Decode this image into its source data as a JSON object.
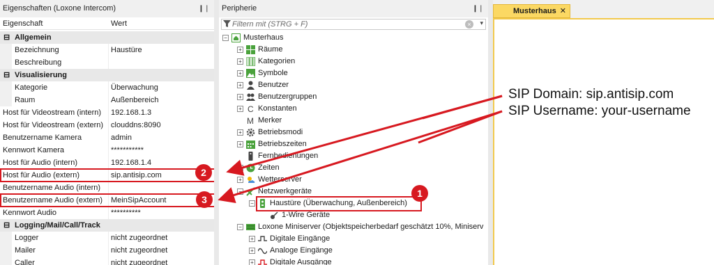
{
  "properties_panel": {
    "title": "Eigenschaften (Loxone Intercom)",
    "pin": "❙❘",
    "header_key": "Eigenschaft",
    "header_value": "Wert",
    "rows": [
      {
        "type": "cat",
        "toggle": "⊟",
        "key": "Allgemein"
      },
      {
        "type": "prop",
        "indent": true,
        "key": "Bezeichnung",
        "value": "Haustüre"
      },
      {
        "type": "prop",
        "indent": true,
        "key": "Beschreibung",
        "value": ""
      },
      {
        "type": "cat",
        "toggle": "⊟",
        "key": "Visualisierung"
      },
      {
        "type": "prop",
        "indent": true,
        "key": "Kategorie",
        "value": "Überwachung"
      },
      {
        "type": "prop",
        "indent": true,
        "key": "Raum",
        "value": "Außenbereich"
      },
      {
        "type": "prop",
        "indent": false,
        "key": "Host für Videostream (intern)",
        "value": "192.168.1.3"
      },
      {
        "type": "prop",
        "indent": false,
        "key": "Host für Videostream (extern)",
        "value": "clouddns:8090"
      },
      {
        "type": "prop",
        "indent": false,
        "key": "Benutzername Kamera",
        "value": "admin"
      },
      {
        "type": "prop",
        "indent": false,
        "key": "Kennwort Kamera",
        "value": "***********"
      },
      {
        "type": "prop",
        "indent": false,
        "key": "Host für Audio (intern)",
        "value": "192.168.1.4"
      },
      {
        "type": "prop",
        "indent": false,
        "key": "Host für Audio (extern)",
        "value": "sip.antisip.com"
      },
      {
        "type": "prop",
        "indent": false,
        "key": "Benutzername Audio (intern)",
        "value": ""
      },
      {
        "type": "prop",
        "indent": false,
        "key": "Benutzername Audio (extern)",
        "value": "MeinSipAccount"
      },
      {
        "type": "prop",
        "indent": false,
        "key": "Kennwort Audio",
        "value": "**********"
      },
      {
        "type": "cat",
        "toggle": "⊟",
        "key": "Logging/Mail/Call/Track"
      },
      {
        "type": "prop",
        "indent": true,
        "key": "Logger",
        "value": "nicht zugeordnet"
      },
      {
        "type": "prop",
        "indent": true,
        "key": "Mailer",
        "value": "nicht zugeordnet"
      },
      {
        "type": "prop",
        "indent": true,
        "key": "Caller",
        "value": "nicht zugeordnet"
      }
    ]
  },
  "peripherals_panel": {
    "title": "Peripherie",
    "pin": "❙❘",
    "filter_placeholder": "Filtern mit (STRG + F)",
    "filter_clear": "×",
    "filter_dropdown": "▾",
    "tree": [
      {
        "exp": "⊟",
        "icon": "home",
        "label": "Musterhaus"
      },
      {
        "exp": "⊞",
        "icon": "grid",
        "label": "Räume"
      },
      {
        "exp": "⊞",
        "icon": "bars",
        "label": "Kategorien"
      },
      {
        "exp": "⊞",
        "icon": "picture",
        "label": "Symbole"
      },
      {
        "exp": "⊞",
        "icon": "user",
        "label": "Benutzer"
      },
      {
        "exp": "⊞",
        "icon": "users",
        "label": "Benutzergruppen"
      },
      {
        "exp": "⊞",
        "icon": "C",
        "label": "Konstanten"
      },
      {
        "exp": "",
        "icon": "M",
        "label": "Merker"
      },
      {
        "exp": "⊞",
        "icon": "gear",
        "label": "Betriebsmodi"
      },
      {
        "exp": "⊞",
        "icon": "calendar",
        "label": "Betriebszeiten"
      },
      {
        "exp": "",
        "icon": "remote",
        "label": "Fernbedienungen"
      },
      {
        "exp": "⊞",
        "icon": "clock",
        "label": "Zeiten"
      },
      {
        "exp": "⊞",
        "icon": "weather",
        "label": "Wetterserver"
      },
      {
        "exp": "⊟",
        "icon": "network",
        "label": "Netzwerkgeräte"
      },
      {
        "exp": "⊟",
        "icon": "intercom",
        "label": "Haustüre (Überwachung, Außenbereich)"
      },
      {
        "exp": "",
        "icon": "wire",
        "label": "1-Wire Geräte"
      },
      {
        "exp": "⊟",
        "icon": "miniserver",
        "label": "Loxone Miniserver (Objektspeicherbedarf geschätzt 10%, Miniserv"
      },
      {
        "exp": "⊞",
        "icon": "dig-in",
        "label": "Digitale Eingänge"
      },
      {
        "exp": "⊞",
        "icon": "ana-in",
        "label": "Analoge Eingänge"
      },
      {
        "exp": "⊞",
        "icon": "dig-out",
        "label": "Digitale Ausgänge"
      }
    ]
  },
  "document": {
    "tab_label": "Musterhaus",
    "tab_close": "✕"
  },
  "annotations": {
    "line1": "SIP Domain: sip.antisip.com",
    "line2": "SIP Username: your-username",
    "badges": [
      "1",
      "2",
      "3"
    ],
    "color": "#d71920"
  }
}
